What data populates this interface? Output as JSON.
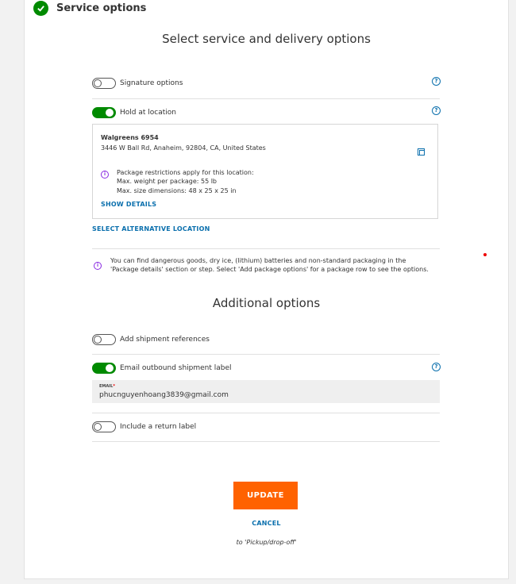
{
  "section": {
    "title": "Service options"
  },
  "main_heading": "Select service and delivery options",
  "signature": {
    "label": "Signature options",
    "enabled": false
  },
  "hold_at_location": {
    "label": "Hold at location",
    "enabled": true,
    "location_name": "Walgreens 6954",
    "address": "3446 W Ball Rd, Anaheim, 92804, CA, United States",
    "restrictions_title": "Package restrictions apply for this location:",
    "max_weight": "Max. weight per package: 55 lb",
    "max_size": "Max. size dimensions: 48 x 25 x 25 in",
    "show_details": "SHOW DETAILS",
    "select_alternative": "SELECT ALTERNATIVE LOCATION"
  },
  "notice": {
    "line1": "You can find dangerous goods, dry ice, (lithium) batteries and non-standard packaging in the",
    "line2": "'Package details' section or step. Select 'Add package options' for a package row to see the options."
  },
  "additional_heading": "Additional options",
  "shipment_references": {
    "label": "Add shipment references",
    "enabled": false
  },
  "email_label": {
    "label": "Email outbound shipment label",
    "enabled": true,
    "field_label": "EMAIL",
    "required_mark": "*",
    "value": "phucnguyenhoang3839@gmail.com"
  },
  "return_label": {
    "label": "Include a return label",
    "enabled": false
  },
  "actions": {
    "update": "UPDATE",
    "cancel": "CANCEL",
    "footer_note": "to 'Pickup/drop-off'"
  },
  "colors": {
    "accent": "#ff6200",
    "toggle_on": "#008a00",
    "link": "#0a6fad",
    "info": "#8a2be2"
  }
}
